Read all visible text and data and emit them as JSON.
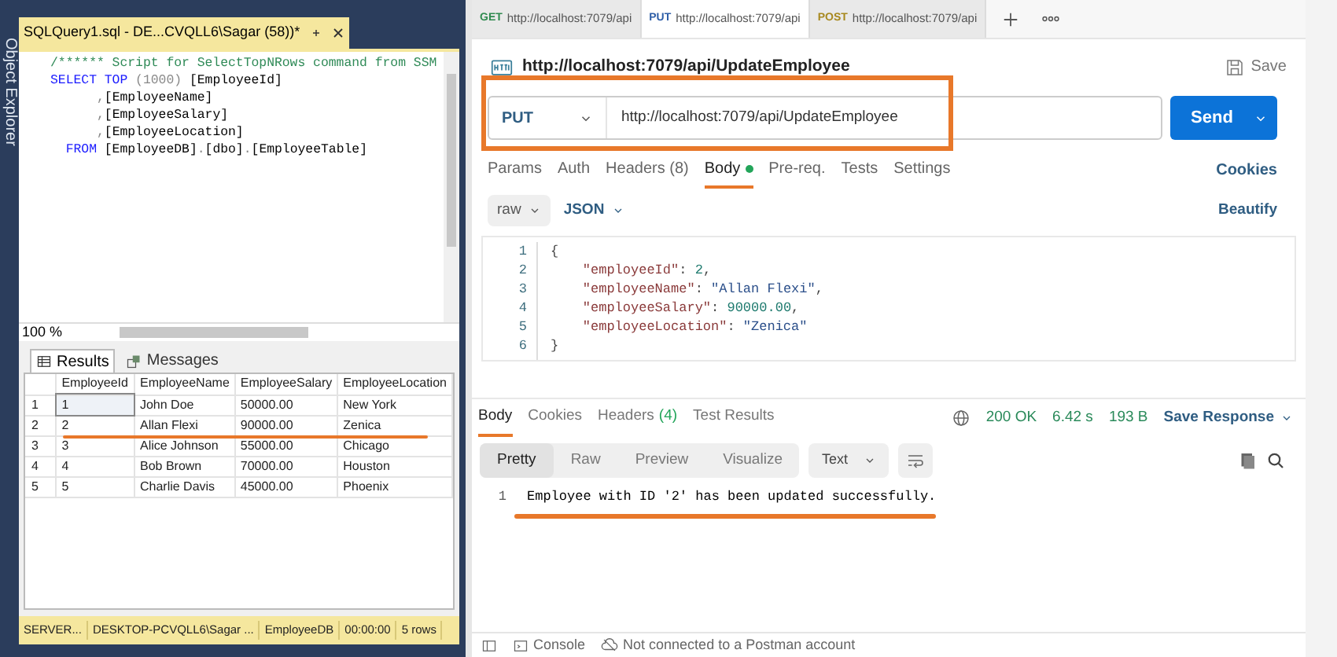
{
  "side_panel": {
    "label": "Object Explorer"
  },
  "ssms": {
    "tab_title": "SQLQuery1.sql - DE...CVQLL6\\Sagar (58))*",
    "query_lines": [
      {
        "tokens": [
          {
            "kind": "comment",
            "text": "/****** Script for SelectTopNRows command from SSM"
          }
        ]
      },
      {
        "tokens": [
          {
            "kind": "keyword",
            "text": "SELECT"
          },
          {
            "kind": "keyword",
            "text": " TOP"
          },
          {
            "kind": "gray",
            "text": " (1000)"
          },
          {
            "kind": "plain",
            "text": " [EmployeeId]"
          }
        ]
      },
      {
        "tokens": [
          {
            "kind": "gray",
            "text": "      ,"
          },
          {
            "kind": "plain",
            "text": "[EmployeeName]"
          }
        ]
      },
      {
        "tokens": [
          {
            "kind": "gray",
            "text": "      ,"
          },
          {
            "kind": "plain",
            "text": "[EmployeeSalary]"
          }
        ]
      },
      {
        "tokens": [
          {
            "kind": "gray",
            "text": "      ,"
          },
          {
            "kind": "plain",
            "text": "[EmployeeLocation]"
          }
        ]
      },
      {
        "tokens": [
          {
            "kind": "keyword",
            "text": "  FROM"
          },
          {
            "kind": "plain",
            "text": " [EmployeeDB]"
          },
          {
            "kind": "gray",
            "text": "."
          },
          {
            "kind": "plain",
            "text": "[dbo]"
          },
          {
            "kind": "gray",
            "text": "."
          },
          {
            "kind": "plain",
            "text": "[EmployeeTable]"
          }
        ]
      }
    ],
    "zoom": "100 %",
    "result_tabs": [
      {
        "label": "Results",
        "selected": true
      },
      {
        "label": "Messages",
        "selected": false
      }
    ],
    "grid": {
      "columns": [
        "EmployeeId",
        "EmployeeName",
        "EmployeeSalary",
        "EmployeeLocation"
      ],
      "rows": [
        {
          "number": "1",
          "selected": true,
          "cells": [
            "1",
            "John Doe",
            "50000.00",
            "New York"
          ]
        },
        {
          "number": "2",
          "selected": false,
          "cells": [
            "2",
            "Allan Flexi",
            "90000.00",
            "Zenica"
          ]
        },
        {
          "number": "3",
          "selected": false,
          "cells": [
            "3",
            "Alice Johnson",
            "55000.00",
            "Chicago"
          ]
        },
        {
          "number": "4",
          "selected": false,
          "cells": [
            "4",
            "Bob Brown",
            "70000.00",
            "Houston"
          ]
        },
        {
          "number": "5",
          "selected": false,
          "cells": [
            "5",
            "Charlie Davis",
            "45000.00",
            "Phoenix"
          ]
        }
      ]
    },
    "status_bar": [
      "SERVER...",
      "DESKTOP-PCVQLL6\\Sagar ...",
      "EmployeeDB",
      "00:00:00",
      "5 rows"
    ]
  },
  "postman": {
    "tabs": [
      {
        "method": "GET",
        "color": "#2f8a4f",
        "url": "http://localhost:7079/api",
        "selected": false
      },
      {
        "method": "PUT",
        "color": "#2f5fa8",
        "url": "http://localhost:7079/api",
        "selected": true
      },
      {
        "method": "POST",
        "color": "#a8891f",
        "url": "http://localhost:7079/api",
        "selected": false
      }
    ],
    "request": {
      "title": "http://localhost:7079/api/UpdateEmployee",
      "save": "Save",
      "method": "PUT",
      "url": "http://localhost:7079/api/UpdateEmployee",
      "send": "Send"
    },
    "request_tabs": [
      {
        "label": "Params",
        "selected": false,
        "dot": false
      },
      {
        "label": "Auth",
        "selected": false,
        "dot": false
      },
      {
        "label": "Headers (8)",
        "selected": false,
        "dot": false
      },
      {
        "label": "Body",
        "selected": true,
        "dot": true
      },
      {
        "label": "Pre-req.",
        "selected": false,
        "dot": false
      },
      {
        "label": "Tests",
        "selected": false,
        "dot": false
      },
      {
        "label": "Settings",
        "selected": false,
        "dot": false
      }
    ],
    "cookies": "Cookies",
    "body_mode": "raw",
    "body_format": "JSON",
    "beautify": "Beautify",
    "body_lines": [
      {
        "number": "1",
        "tokens": [
          {
            "kind": "punct",
            "text": "{"
          }
        ]
      },
      {
        "number": "2",
        "tokens": [
          {
            "kind": "key",
            "text": "    \"employeeId\""
          },
          {
            "kind": "punct",
            "text": ": "
          },
          {
            "kind": "num",
            "text": "2"
          },
          {
            "kind": "punct",
            "text": ","
          }
        ]
      },
      {
        "number": "3",
        "tokens": [
          {
            "kind": "key",
            "text": "    \"employeeName\""
          },
          {
            "kind": "punct",
            "text": ": "
          },
          {
            "kind": "str",
            "text": "\"Allan Flexi\""
          },
          {
            "kind": "punct",
            "text": ","
          }
        ]
      },
      {
        "number": "4",
        "tokens": [
          {
            "kind": "key",
            "text": "    \"employeeSalary\""
          },
          {
            "kind": "punct",
            "text": ": "
          },
          {
            "kind": "num",
            "text": "90000.00"
          },
          {
            "kind": "punct",
            "text": ","
          }
        ]
      },
      {
        "number": "5",
        "tokens": [
          {
            "kind": "key",
            "text": "    \"employeeLocation\""
          },
          {
            "kind": "punct",
            "text": ": "
          },
          {
            "kind": "str",
            "text": "\"Zenica\""
          }
        ]
      },
      {
        "number": "6",
        "tokens": [
          {
            "kind": "punct",
            "text": "}"
          }
        ]
      }
    ],
    "response_tabs": [
      {
        "label": "Body",
        "selected": true
      },
      {
        "label": "Cookies",
        "selected": false
      },
      {
        "label": "Headers",
        "count": "(4)",
        "selected": false
      },
      {
        "label": "Test Results",
        "selected": false
      }
    ],
    "status": "200 OK",
    "time": "6.42 s",
    "size": "193 B",
    "save_response": "Save Response",
    "view_tabs": [
      {
        "label": "Pretty",
        "selected": true
      },
      {
        "label": "Raw",
        "selected": false
      },
      {
        "label": "Preview",
        "selected": false
      },
      {
        "label": "Visualize",
        "selected": false
      }
    ],
    "view_format": "Text",
    "response_lines": [
      {
        "number": "1",
        "text": "Employee with ID '2' has been updated successfully."
      }
    ],
    "footer": {
      "console": "Console",
      "account": "Not connected to a Postman account"
    }
  }
}
